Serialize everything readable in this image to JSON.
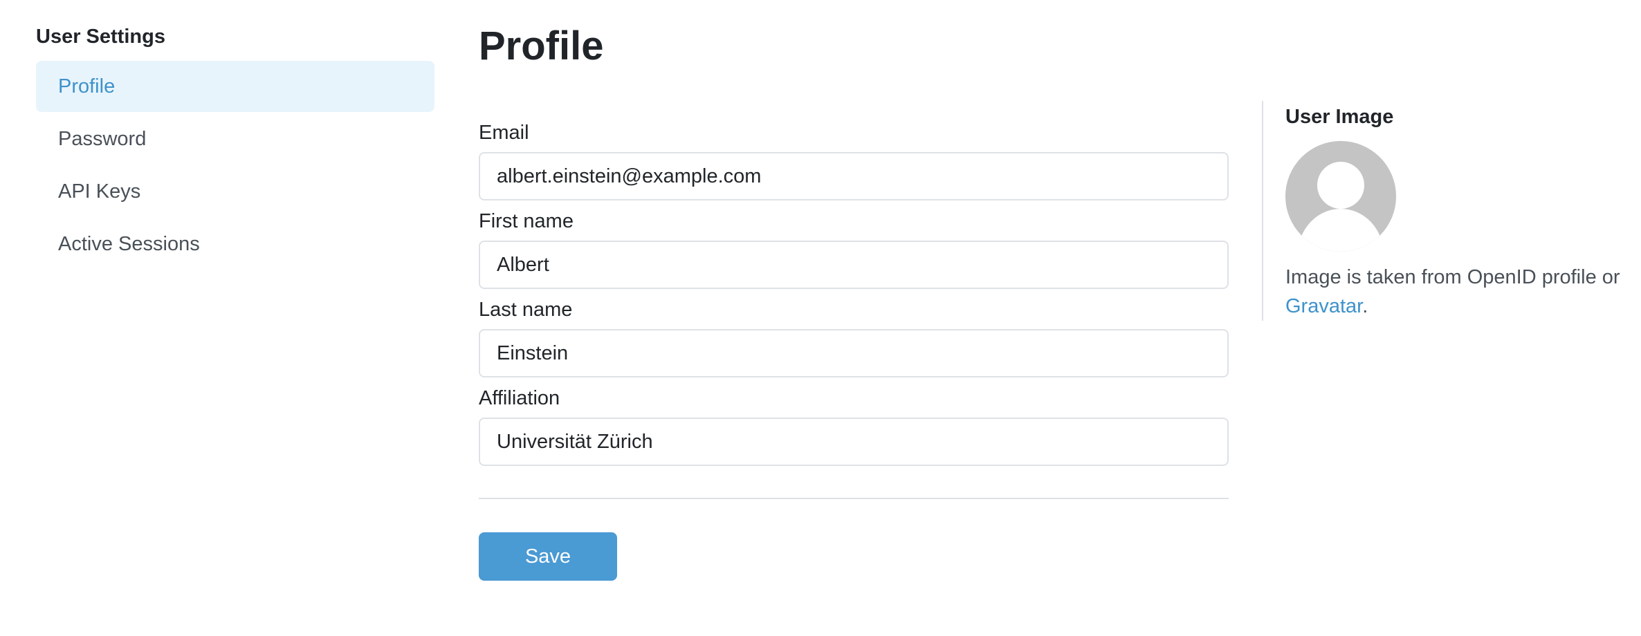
{
  "sidebar": {
    "title": "User Settings",
    "items": [
      {
        "label": "Profile",
        "active": true
      },
      {
        "label": "Password",
        "active": false
      },
      {
        "label": "API Keys",
        "active": false
      },
      {
        "label": "Active Sessions",
        "active": false
      }
    ]
  },
  "main": {
    "title": "Profile",
    "fields": {
      "email": {
        "label": "Email",
        "value": "albert.einstein@example.com"
      },
      "first_name": {
        "label": "First name",
        "value": "Albert"
      },
      "last_name": {
        "label": "Last name",
        "value": "Einstein"
      },
      "affiliation": {
        "label": "Affiliation",
        "value": "Universität Zürich"
      }
    },
    "save_label": "Save"
  },
  "user_image": {
    "title": "User Image",
    "avatar_icon": "default-user-avatar-icon",
    "note_prefix": "Image is taken from OpenID profile or",
    "note_link": "Gravatar",
    "note_suffix": "."
  },
  "colors": {
    "accent": "#3d92cc",
    "active_nav_bg": "#e8f4fb",
    "save_button": "#4a9ad4",
    "avatar_bg": "#c4c4c4"
  }
}
